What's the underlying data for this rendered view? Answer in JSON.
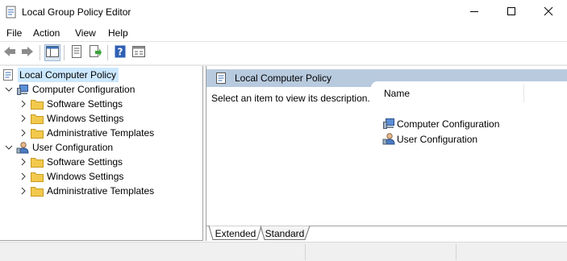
{
  "window": {
    "title": "Local Group Policy Editor",
    "icons": {
      "app": "policy-editor-icon",
      "minimize": "minimize-icon",
      "maximize": "maximize-icon",
      "close": "close-icon"
    }
  },
  "menu": {
    "items": [
      "File",
      "Action",
      "View",
      "Help"
    ]
  },
  "toolbar": {
    "icons": [
      "back-arrow-icon",
      "forward-arrow-icon",
      "show-hide-console-tree-icon",
      "properties-icon",
      "export-list-icon",
      "help-icon",
      "extended-view-icon"
    ]
  },
  "tree": {
    "root": {
      "label": "Local Computer Policy",
      "icon": "policy-scroll-icon",
      "selected": true
    },
    "nodes": [
      {
        "label": "Computer Configuration",
        "icon": "computer-icon",
        "expanded": true,
        "children": [
          {
            "label": "Software Settings",
            "icon": "folder-icon"
          },
          {
            "label": "Windows Settings",
            "icon": "folder-icon"
          },
          {
            "label": "Administrative Templates",
            "icon": "folder-icon"
          }
        ]
      },
      {
        "label": "User Configuration",
        "icon": "user-icon",
        "expanded": true,
        "children": [
          {
            "label": "Software Settings",
            "icon": "folder-icon"
          },
          {
            "label": "Windows Settings",
            "icon": "folder-icon"
          },
          {
            "label": "Administrative Templates",
            "icon": "folder-icon"
          }
        ]
      }
    ]
  },
  "details": {
    "header": "Local Computer Policy",
    "description": "Select an item to view its description.",
    "columns": [
      "Name"
    ],
    "items": [
      {
        "label": "Computer Configuration",
        "icon": "computer-icon"
      },
      {
        "label": "User Configuration",
        "icon": "user-icon"
      }
    ]
  },
  "tabs": [
    {
      "label": "Extended",
      "active": true
    },
    {
      "label": "Standard",
      "active": false
    }
  ],
  "colors": {
    "selection": "#cce8ff",
    "header_band": "#b8cade",
    "folder": "#f2c94c"
  }
}
